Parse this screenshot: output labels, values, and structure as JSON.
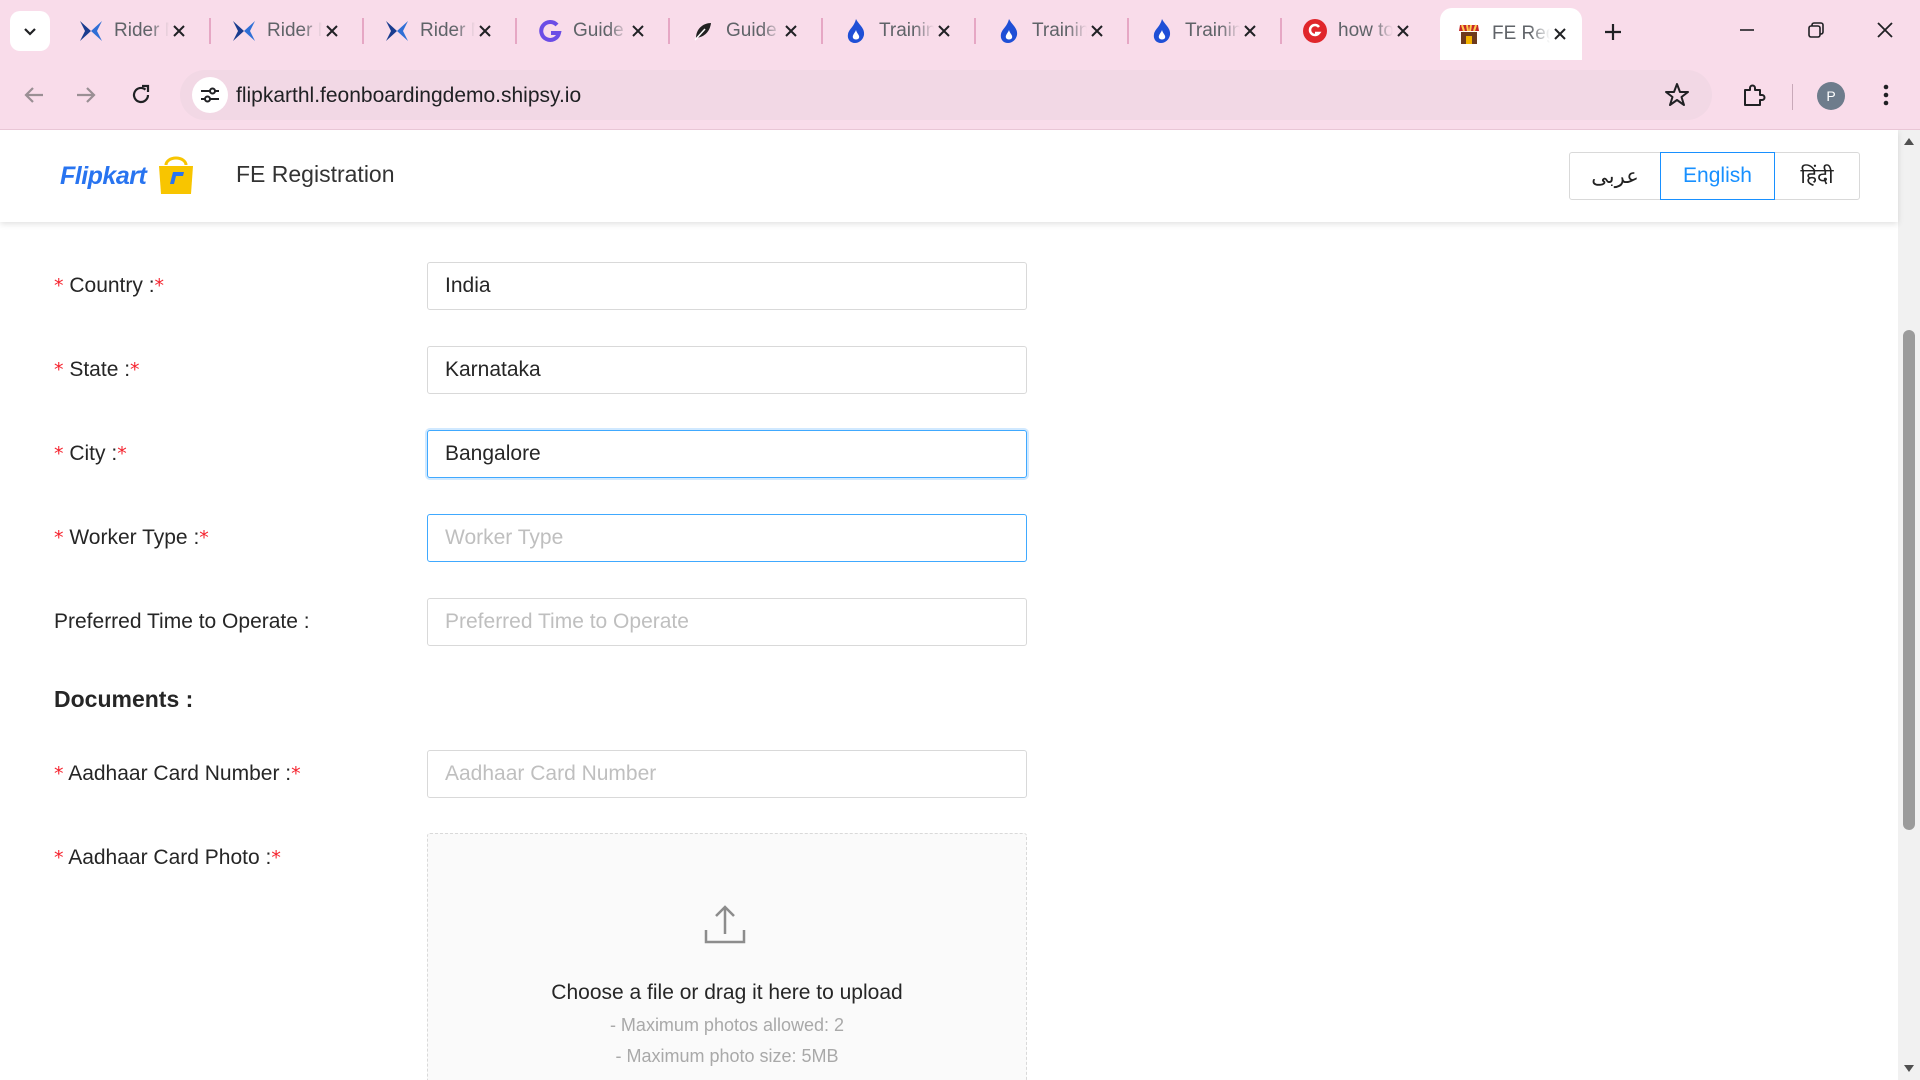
{
  "browser": {
    "tabs": [
      {
        "title": "Rider Management",
        "icon": "rider-logo-icon"
      },
      {
        "title": "Rider Management",
        "icon": "rider-logo-icon"
      },
      {
        "title": "Rider Management",
        "icon": "rider-logo-icon"
      },
      {
        "title": "Guide",
        "icon": "g-logo-icon"
      },
      {
        "title": "Guide",
        "icon": "feather-icon"
      },
      {
        "title": "Training",
        "icon": "flame-icon"
      },
      {
        "title": "Training",
        "icon": "flame-icon"
      },
      {
        "title": "Training",
        "icon": "flame-icon"
      },
      {
        "title": "how to",
        "icon": "g-red-icon"
      },
      {
        "title": "FE Registration",
        "icon": "store-icon"
      }
    ],
    "url": "flipkarthl.feonboardingdemo.shipsy.io",
    "profile_initial": "P"
  },
  "header": {
    "logo_text": "Flipkart",
    "title": "FE Registration",
    "languages": [
      "عربى",
      "English",
      "हिंदी"
    ],
    "active_language": "English"
  },
  "form": {
    "country": {
      "label": "Country :",
      "value": "India"
    },
    "state": {
      "label": "State :",
      "value": "Karnataka"
    },
    "city": {
      "label": "City :",
      "value": "Bangalore"
    },
    "worker_type": {
      "label": "Worker Type :",
      "placeholder": "Worker Type"
    },
    "preferred_time": {
      "label": "Preferred Time to Operate :",
      "placeholder": "Preferred Time to Operate"
    },
    "documents_heading": "Documents :",
    "aadhaar_number": {
      "label": "Aadhaar Card Number :",
      "placeholder": "Aadhaar Card Number"
    },
    "aadhaar_photo": {
      "label": "Aadhaar Card Photo :",
      "upload_text": "Choose a file or drag it here to upload",
      "hint_max_photos": "- Maximum photos allowed: 2",
      "hint_max_size": "- Maximum photo size: 5MB"
    },
    "required_mark": "*"
  },
  "colors": {
    "brand_blue": "#2874f0",
    "accent": "#1890ff",
    "required": "#f5222d",
    "chrome_pink": "#f9dcea"
  }
}
